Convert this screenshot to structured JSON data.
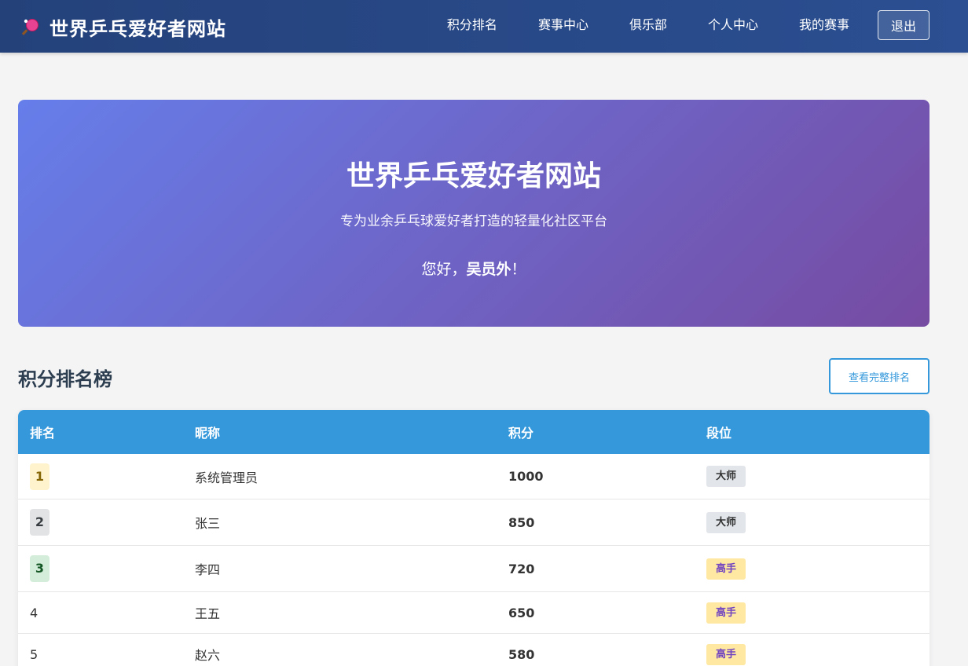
{
  "nav": {
    "brand": "世界乒乓爱好者网站",
    "links": [
      "积分排名",
      "赛事中心",
      "俱乐部",
      "个人中心",
      "我的赛事"
    ],
    "logout": "退出"
  },
  "hero": {
    "title": "世界乒乓爱好者网站",
    "subtitle": "专为业余乒乓球爱好者打造的轻量化社区平台",
    "greeting_prefix": "您好，",
    "username": "吴员外",
    "greeting_suffix": "！"
  },
  "ranking": {
    "title": "积分排名榜",
    "full_button": "查看完整排名",
    "headers": [
      "排名",
      "昵称",
      "积分",
      "段位"
    ],
    "rows": [
      {
        "rank": "1",
        "name": "系统管理员",
        "score": "1000",
        "level": "大师"
      },
      {
        "rank": "2",
        "name": "张三",
        "score": "850",
        "level": "大师"
      },
      {
        "rank": "3",
        "name": "李四",
        "score": "720",
        "level": "高手"
      },
      {
        "rank": "4",
        "name": "王五",
        "score": "650",
        "level": "高手"
      },
      {
        "rank": "5",
        "name": "赵六",
        "score": "580",
        "level": "高手"
      }
    ]
  },
  "colors": {
    "navbar": "#24417a",
    "table_header": "#3498db",
    "hero_start": "#667eea",
    "hero_end": "#764ba2",
    "rank1_bg": "#fff3cd",
    "rank1_fg": "#856404",
    "rank2_bg": "#e2e3e5",
    "rank2_fg": "#383d41",
    "rank3_bg": "#d4edda",
    "rank3_fg": "#155724",
    "level_master_bg": "#e2e6ea",
    "level_master_fg": "#333333",
    "level_expert_bg": "#ffe8a1",
    "level_expert_fg": "#6f42c1"
  },
  "icons": {
    "brand": "ping-pong-paddle-icon"
  }
}
